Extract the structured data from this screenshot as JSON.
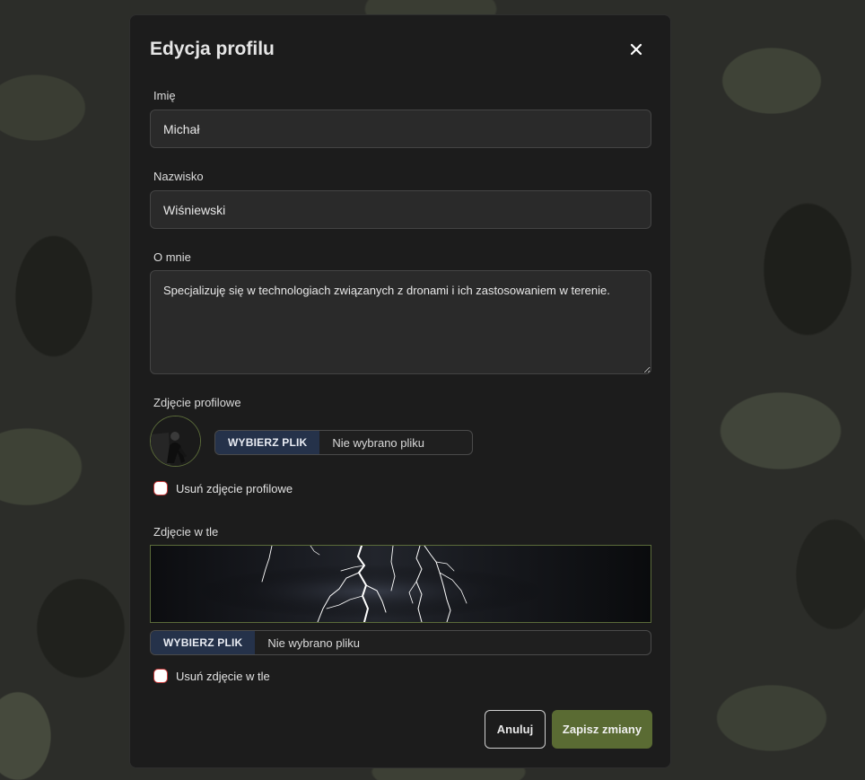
{
  "modal": {
    "title": "Edycja profilu"
  },
  "form": {
    "first_name": {
      "label": "Imię",
      "value": "Michał"
    },
    "last_name": {
      "label": "Nazwisko",
      "value": "Wiśniewski"
    },
    "about": {
      "label": "O mnie",
      "value": "Specjalizuję się w technologiach związanych z dronami i ich zastosowaniem w terenie."
    },
    "profile_photo": {
      "label": "Zdjęcie profilowe",
      "file_button": "WYBIERZ PLIK",
      "file_status": "Nie wybrano pliku",
      "remove_label": "Usuń zdjęcie profilowe"
    },
    "background_photo": {
      "label": "Zdjęcie w tle",
      "file_button": "WYBIERZ PLIK",
      "file_status": "Nie wybrano pliku",
      "remove_label": "Usuń zdjęcie w tle"
    }
  },
  "actions": {
    "cancel": "Anuluj",
    "save": "Zapisz zmiany"
  },
  "icons": {
    "close": "close-icon"
  },
  "colors": {
    "accent": "#5a6b33",
    "file_button_bg": "#25324a",
    "checkbox_border": "#c93a3a",
    "modal_bg": "#1c1c1c"
  }
}
